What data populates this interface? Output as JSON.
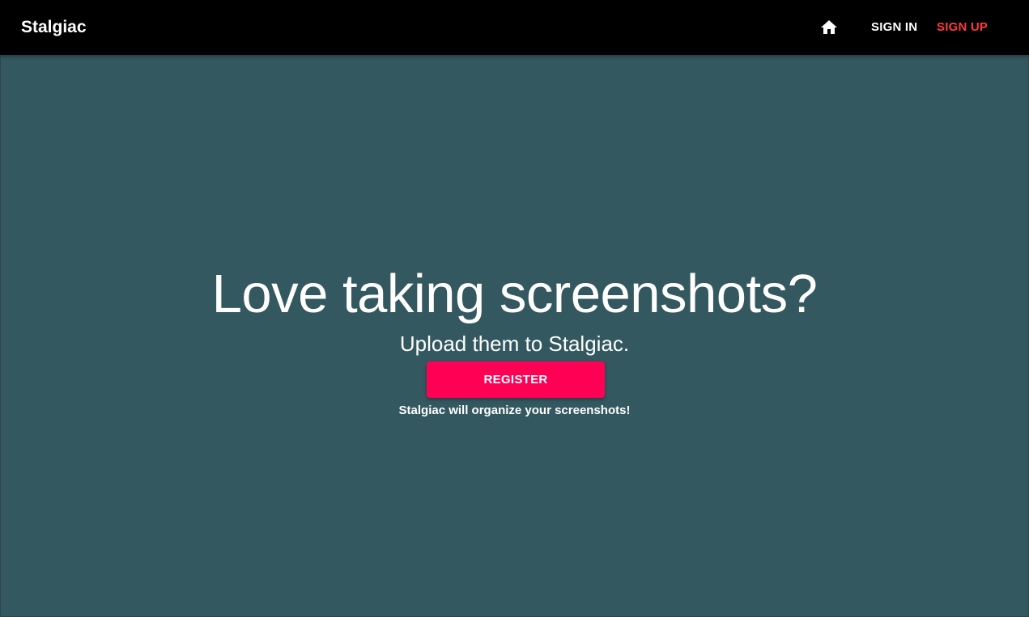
{
  "header": {
    "brand": "Stalgiac",
    "home_icon": "home-icon",
    "nav": {
      "sign_in": "SIGN IN",
      "sign_up": "SIGN UP"
    }
  },
  "hero": {
    "title": "Love taking screenshots?",
    "subtitle": "Upload them to Stalgiac.",
    "cta_label": "REGISTER",
    "caption": "Stalgiac will organize your screenshots!"
  },
  "colors": {
    "background": "#345860",
    "app_bar": "#000000",
    "accent": "#ff0055",
    "sign_up_link": "#ff3b3b",
    "text": "#ffffff"
  }
}
